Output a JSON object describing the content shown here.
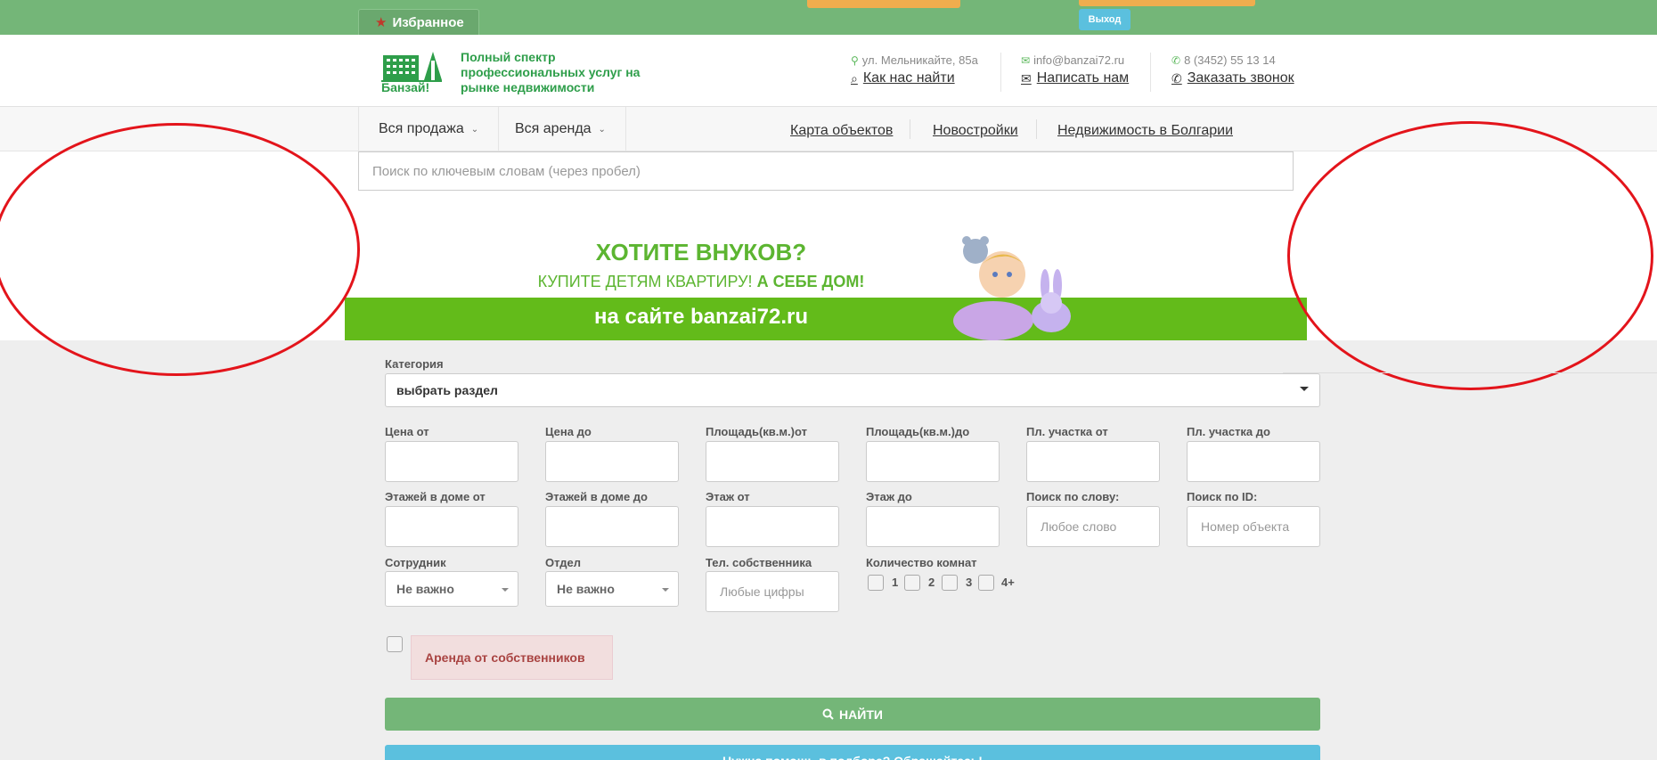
{
  "topbar": {
    "favorites_label": "Избранное",
    "logout_label": "Выход"
  },
  "header": {
    "logo_caption": "Банзай!",
    "tagline": "Полный спектр профессиональных услуг на рынке недвижимости",
    "address": "ул. Мельникайте, 85а",
    "find_us": "Как нас найти",
    "email": "info@banzai72.ru",
    "write_us": "Написать нам",
    "phone": "8 (3452) 55 13 14",
    "order_call": "Заказать звонок"
  },
  "nav": {
    "all_sale": "Вся продажа",
    "all_rent": "Вся аренда",
    "links": [
      "Карта объектов",
      "Новостройки",
      "Недвижимость в Болгарии"
    ]
  },
  "search": {
    "placeholder": "Поиск по ключевым словам (через пробел)"
  },
  "banner": {
    "line1": "ХОТИТЕ ВНУКОВ?",
    "line2_a": "КУПИТЕ ДЕТЯМ КВАРТИРУ!",
    "line2_b": "А СЕБЕ ДОМ!",
    "line3": "на сайте banzai72.ru"
  },
  "form": {
    "category_label": "Категория",
    "category_value": "выбрать раздел",
    "price_from": "Цена от",
    "price_to": "Цена до",
    "area_from": "Площадь(кв.м.)от",
    "area_to": "Площадь(кв.м.)до",
    "plot_from": "Пл. участка от",
    "plot_to": "Пл. участка до",
    "floors_from": "Этажей в доме от",
    "floors_to": "Этажей в доме до",
    "floor_from": "Этаж от",
    "floor_to": "Этаж до",
    "word_search_label": "Поиск по слову:",
    "word_search_placeholder": "Любое слово",
    "id_search_label": "Поиск по ID:",
    "id_search_placeholder": "Номер объекта",
    "employee_label": "Сотрудник",
    "employee_value": "Не важно",
    "department_label": "Отдел",
    "department_value": "Не важно",
    "owner_phone_label": "Тел. собственника",
    "owner_phone_placeholder": "Любые цифры",
    "rooms_label": "Количество комнат",
    "rooms": [
      "1",
      "2",
      "3",
      "4+"
    ],
    "owner_rent_label": "Аренда от собственников",
    "find_button": "НАЙТИ",
    "help_button": "Нужна помощь в подборе? Обращайтесь!"
  },
  "colors": {
    "topbar_green": "#74b678",
    "brand_green": "#2e9e4a",
    "annotation_red": "#e3141b",
    "info_blue": "#5bc0de",
    "warning_orange": "#f0ad4e"
  }
}
